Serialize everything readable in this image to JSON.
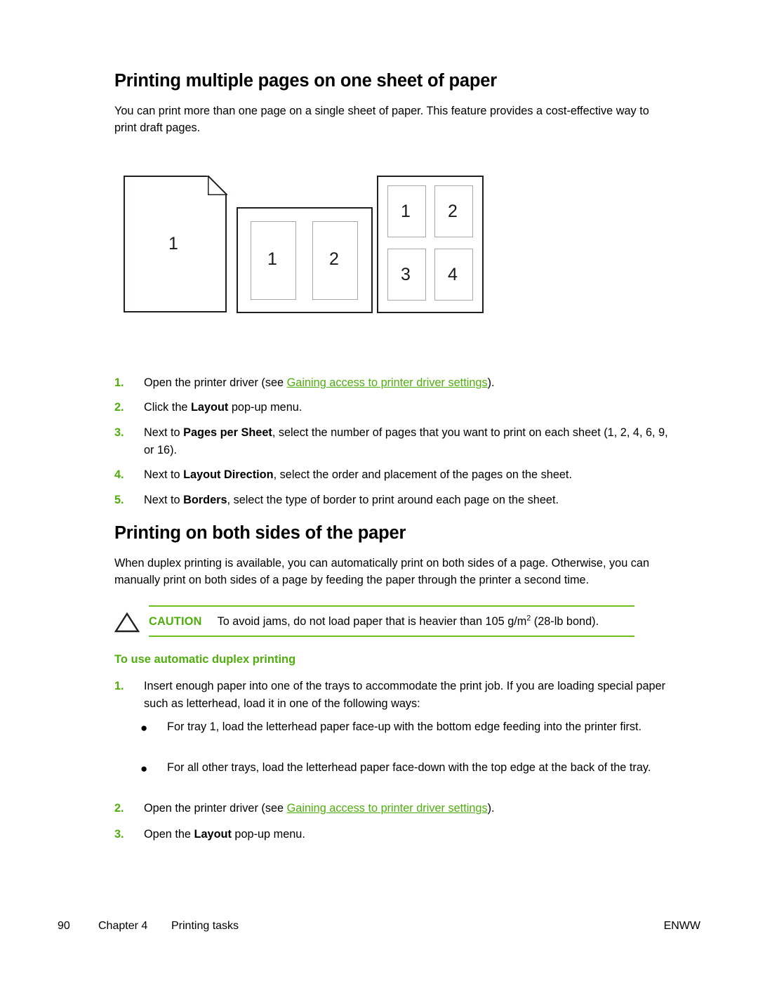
{
  "section1": {
    "heading": "Printing multiple pages on one sheet of paper",
    "intro": "You can print more than one page on a single sheet of paper. This feature provides a cost-effective way to print draft pages.",
    "figure": {
      "caption_alt": "Diagram showing 1-up, 2-up and 4-up page layouts on a sheet",
      "sheet_1up": {
        "labels": [
          "1"
        ]
      },
      "sheet_2up": {
        "labels": [
          "1",
          "2"
        ]
      },
      "sheet_4up": {
        "labels": [
          "1",
          "2",
          "3",
          "4"
        ]
      }
    },
    "steps": [
      {
        "num": "1.",
        "pre": "Open the printer driver (see ",
        "link": "Gaining access to printer driver settings",
        "post": ")."
      },
      {
        "num": "2.",
        "pre": "Click the ",
        "bold": "Layout",
        "post": " pop-up menu."
      },
      {
        "num": "3.",
        "pre": "Next to ",
        "bold": "Pages per Sheet",
        "post": ", select the number of pages that you want to print on each sheet (1, 2, 4, 6, 9, or 16)."
      },
      {
        "num": "4.",
        "pre": "Next to ",
        "bold": "Layout Direction",
        "post": ", select the order and placement of the pages on the sheet."
      },
      {
        "num": "5.",
        "pre": "Next to ",
        "bold": "Borders",
        "post": ", select the type of border to print around each page on the sheet."
      }
    ]
  },
  "section2": {
    "heading": "Printing on both sides of the paper",
    "intro": "When duplex printing is available, you can automatically print on both sides of a page. Otherwise, you can manually print on both sides of a page by feeding the paper through the printer a second time.",
    "caution": {
      "label": "CAUTION",
      "text_before_sup": "To avoid jams, do not load paper that is heavier than 105 g/m",
      "sup": "2",
      "text_after_sup": " (28-lb bond)."
    },
    "subheading": "To use automatic duplex printing",
    "steps": [
      {
        "num": "1.",
        "text": "Insert enough paper into one of the trays to accommodate the print job. If you are loading special paper such as letterhead, load it in one of the following ways:"
      },
      {
        "num": "2.",
        "pre": "Open the printer driver (see ",
        "link": "Gaining access to printer driver settings",
        "post": ")."
      },
      {
        "num": "3.",
        "pre": "Open the ",
        "bold": "Layout",
        "post": " pop-up menu."
      }
    ],
    "bullets": [
      {
        "marker": "●",
        "text": "For tray 1, load the letterhead paper face-up with the bottom edge feeding into the printer first."
      },
      {
        "marker": "●",
        "text": "For all other trays, load the letterhead paper face-down with the top edge at the back of the tray."
      }
    ]
  },
  "footer": {
    "page_number": "90",
    "chapter": "Chapter 4",
    "chapter_title": "Printing tasks",
    "right_label": "ENWW"
  },
  "colors": {
    "accent_green": "#4FAE0D",
    "rule_green": "#6FBF1F",
    "text_black": "#000000",
    "figure_outline": "#241f1f",
    "figure_inner_outline": "#a8a8a8"
  }
}
